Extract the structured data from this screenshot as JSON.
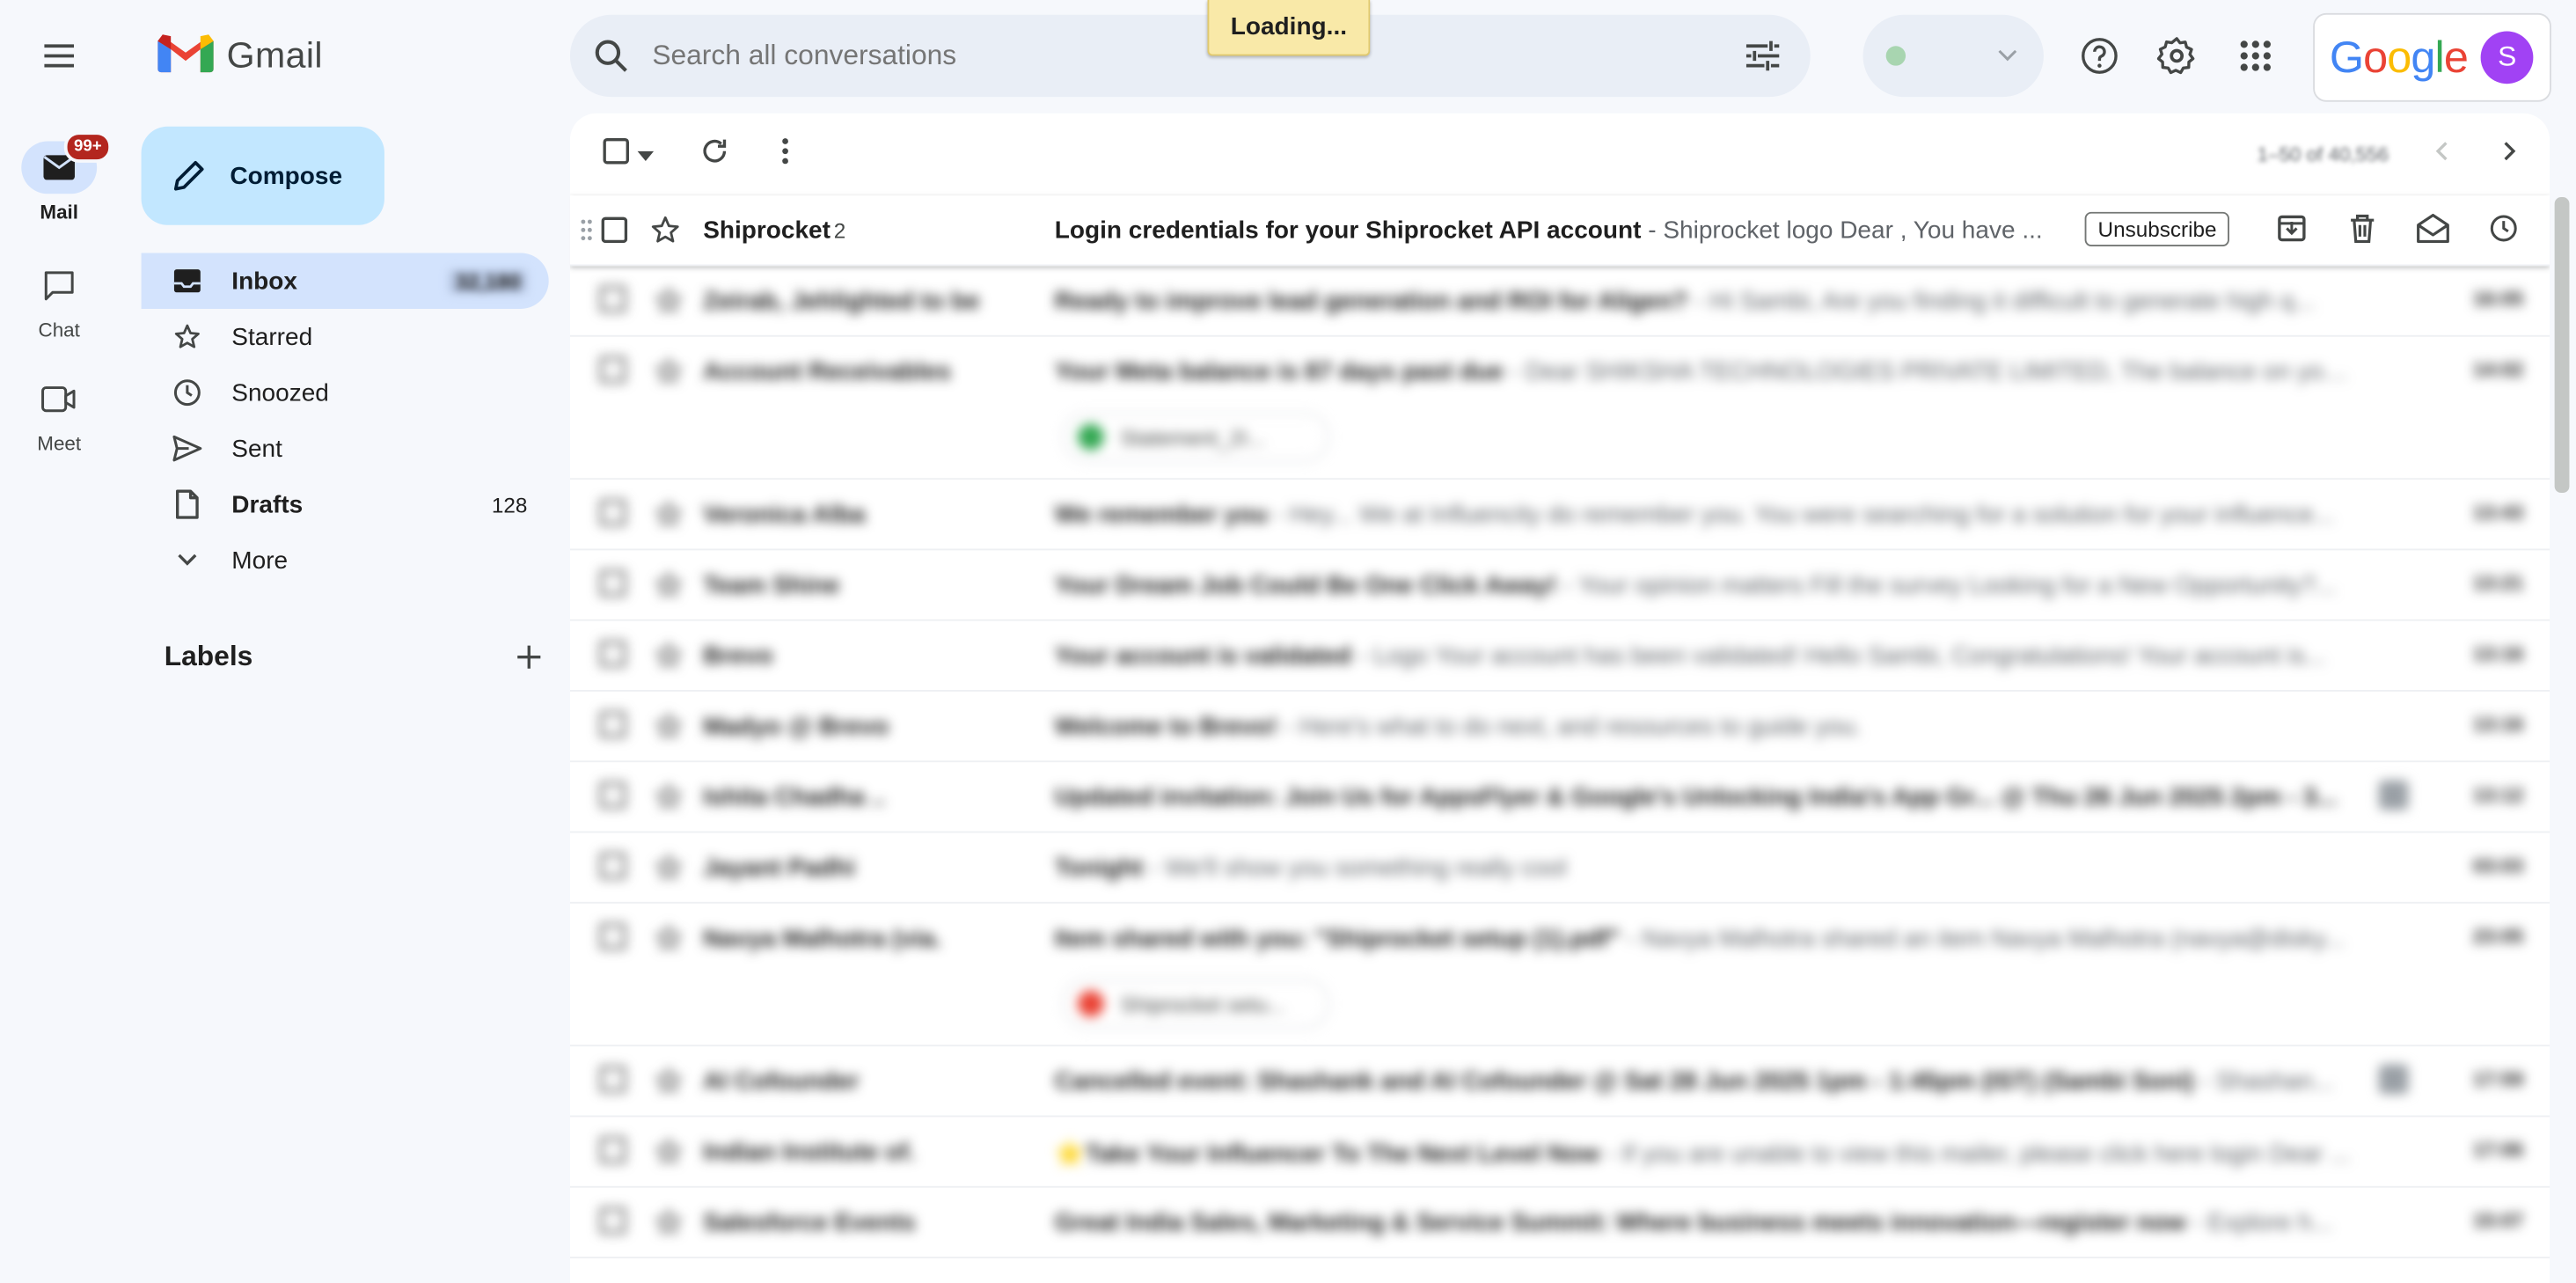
{
  "app": {
    "name": "Gmail",
    "account_brand": "Google",
    "avatar_letter": "S",
    "loading_text": "Loading..."
  },
  "rail": {
    "mail_label": "Mail",
    "mail_badge": "99+",
    "chat_label": "Chat",
    "meet_label": "Meet"
  },
  "compose_label": "Compose",
  "nav": {
    "inbox": {
      "label": "Inbox",
      "count": "32,180"
    },
    "starred": {
      "label": "Starred"
    },
    "snoozed": {
      "label": "Snoozed"
    },
    "sent": {
      "label": "Sent"
    },
    "drafts": {
      "label": "Drafts",
      "count": "128"
    },
    "more": {
      "label": "More"
    }
  },
  "labels_title": "Labels",
  "search": {
    "placeholder": "Search all conversations"
  },
  "toolbar": {
    "pager": "1–50 of 40,556"
  },
  "first_row": {
    "sender": "Shiprocket",
    "count": "2",
    "subject": "Login credentials for your Shiprocket API account",
    "snippet": " - Shiprocket logo Dear , You have ...",
    "unsubscribe": "Unsubscribe"
  },
  "rows": [
    {
      "sender": "Zeirab, Jehlighted to be",
      "subject": "Ready to improve lead generation and ROI for Aligen?",
      "snippet": " - Hi Sambi, Are you finding it difficult to generate high q...",
      "date": "16:05"
    },
    {
      "sender": "Account Receivables",
      "subject": "Your Meta balance is 87 days past due",
      "snippet": " - Dear SHIKSHA TECHNOLOGIES PRIVATE LIMITED, The balance on your ...",
      "date": "14:02",
      "attachment": "Statement_2I...",
      "attachment_color": "#34a853"
    },
    {
      "sender": "Veronica Alba",
      "subject": "We remember you",
      "snippet": " - Hey... We at Influencity do remember you. You were searching for a solution for your influence...",
      "date": "13:43"
    },
    {
      "sender": "Team Shine",
      "subject": "Your Dream Job Could Be One Click Away!",
      "snippet": " - Your opinion matters Fill the survey Looking for a New Opportunity?...",
      "date": "13:21"
    },
    {
      "sender": "Brevo",
      "subject": "Your account is validated",
      "snippet": " - Logo Your account has been validated! Hello Sambi, Congratulations! Your account is...",
      "date": "13:16"
    },
    {
      "sender": "Madyo @ Brevo",
      "subject": "Welcome to Brevo!",
      "snippet": " - Here's what to do next, and resources to guide you.",
      "date": "13:16"
    },
    {
      "sender": "Ishita Chadha ..",
      "subject": "Updated invitation: Join Us for AppsFlyer & Google's Unlocking India's App Gr... @ Thu 26 Jun 2025 2pm - 3...",
      "snippet": "",
      "date": "13:12",
      "calendar": true
    },
    {
      "sender": "Jayant Padhi",
      "subject": "Tonight",
      "snippet": " - We'll show you something really cool",
      "date": "03:03"
    },
    {
      "sender": "Navya Malhotra (via.",
      "subject": "Item shared with you: \"Shiprocket setup (1).pdf\"",
      "snippet": " - Navya Malhotra shared an item Navya Malhotra (navya@disky...",
      "date": "23:05",
      "attachment": "Shiprocket setu...",
      "attachment_color": "#ea4335"
    },
    {
      "sender": "AI Cofounder",
      "subject": "Cancelled event: Shashank and AI Cofounder @ Sat 28 Jun 2025 1pm - 1:45pm (IST) (Sambi Soni)",
      "snippet": " - Shashan...",
      "date": "17:59",
      "calendar": true
    },
    {
      "sender": "Indian Institute of.",
      "subject": "⭐Take Your Influencer To The Next Level Now",
      "snippet": " - If you are unable to view this mailer, please click here login Dear ...",
      "date": "17:06"
    },
    {
      "sender": "Salesforce Events",
      "subject": "Great India Sales, Marketing & Service Summit: Where business meets innovation—register now",
      "snippet": " - Explore h...",
      "date": "15:07"
    }
  ]
}
